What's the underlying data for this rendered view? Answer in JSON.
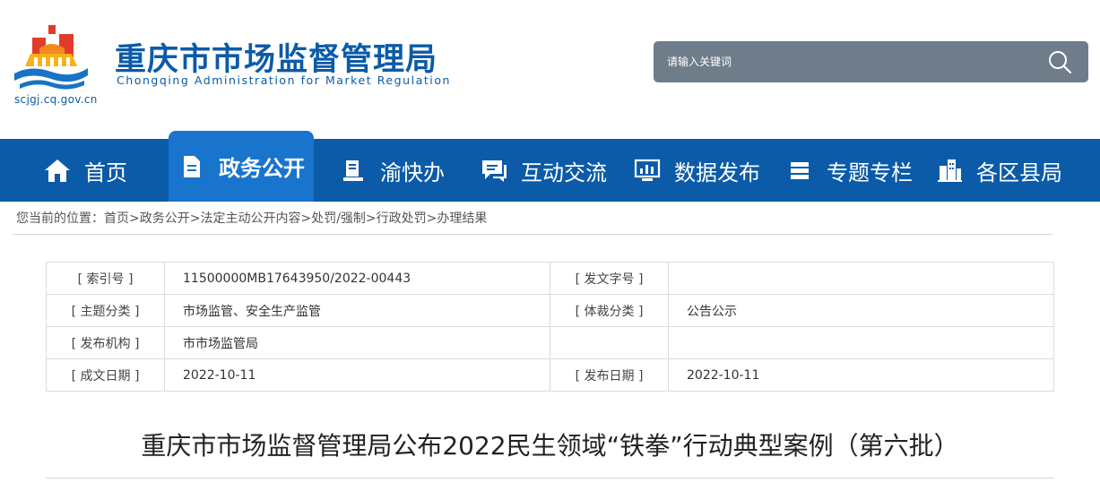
{
  "header": {
    "site_title": "重庆市市场监督管理局",
    "site_subtitle": "Chongqing  Administration for Market Regulation",
    "site_url": "scjgj.cq.gov.cn",
    "search": {
      "placeholder": "请输入关键词"
    }
  },
  "nav": {
    "items": [
      {
        "label": "首页",
        "icon": "home-icon"
      },
      {
        "label": "政务公开",
        "icon": "document-icon",
        "active": true
      },
      {
        "label": "渝快办",
        "icon": "service-icon"
      },
      {
        "label": "互动交流",
        "icon": "chat-icon"
      },
      {
        "label": "数据发布",
        "icon": "chart-icon"
      },
      {
        "label": "专题专栏",
        "icon": "stack-icon"
      },
      {
        "label": "各区县局",
        "icon": "buildings-icon"
      }
    ]
  },
  "breadcrumb": {
    "prefix": "您当前的位置：",
    "items": [
      "首页",
      "政务公开",
      "法定主动公开内容",
      "处罚/强制",
      "行政处罚",
      "办理结果"
    ],
    "separator": ">"
  },
  "info": {
    "index_label": "[ 索引号 ]",
    "index_value": "11500000MB17643950/2022-00443",
    "doc_no_label": "[ 发文字号 ]",
    "doc_no_value": "",
    "topic_label": "[ 主题分类 ]",
    "topic_value": "市场监管、安全生产监管",
    "genre_label": "[ 体裁分类 ]",
    "genre_value": "公告公示",
    "issuer_label": "[ 发布机构 ]",
    "issuer_value": "市市场监管局",
    "written_date_label": "[ 成文日期 ]",
    "written_date_value": "2022-10-11",
    "publish_date_label": "[ 发布日期 ]",
    "publish_date_value": "2022-10-11"
  },
  "article": {
    "title": "重庆市市场监督管理局公布2022民生领域“铁拳”行动典型案例（第六批）"
  },
  "colors": {
    "brand_blue": "#0b5ba8",
    "nav_active": "#1874cc",
    "search_bg": "#6f7c8a"
  }
}
